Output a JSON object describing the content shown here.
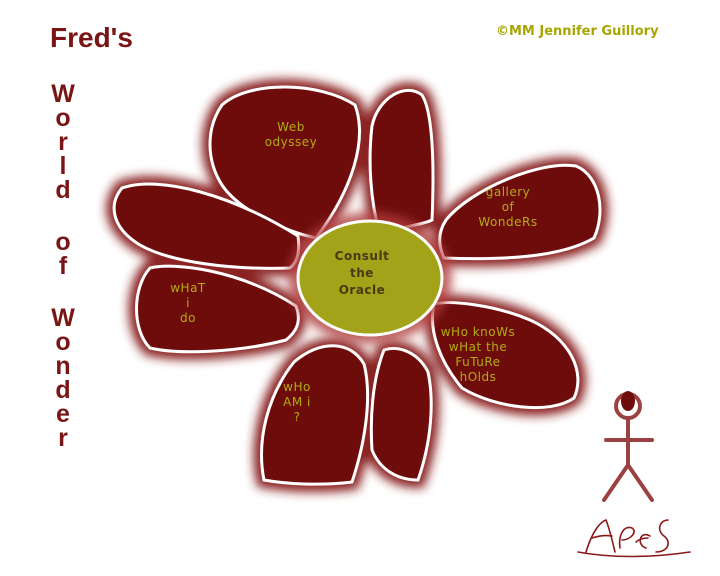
{
  "header": {
    "title": "Fred's",
    "copyright": "©MM Jennifer Guillory"
  },
  "vertical_title": {
    "words": [
      [
        "W",
        "o",
        "r",
        "l",
        "d"
      ],
      [
        "o",
        "f"
      ],
      [
        "W",
        "o",
        "n",
        "d",
        "e",
        "r"
      ]
    ]
  },
  "center": {
    "label": "Consult\nthe\nOracle"
  },
  "petals": [
    {
      "label": "Web\nodyssey"
    },
    {
      "label": "gallery\nof\nWondeRs"
    },
    {
      "label": "wHo knoWs\nwHat the\nFuTuRe\nhOlds"
    },
    {
      "label": "wHo\nAM   i\n?"
    },
    {
      "label": "wHaT\ni\ndo"
    }
  ],
  "colors": {
    "petal_fill": "#6e0c0c",
    "petal_glow": "#8a2020",
    "center_fill": "#a3a31a",
    "title": "#7a1515",
    "label": "#b3ab12"
  },
  "signature": {
    "icon": "signature-scribble"
  },
  "figure": {
    "icon": "stick-figure-icon"
  }
}
